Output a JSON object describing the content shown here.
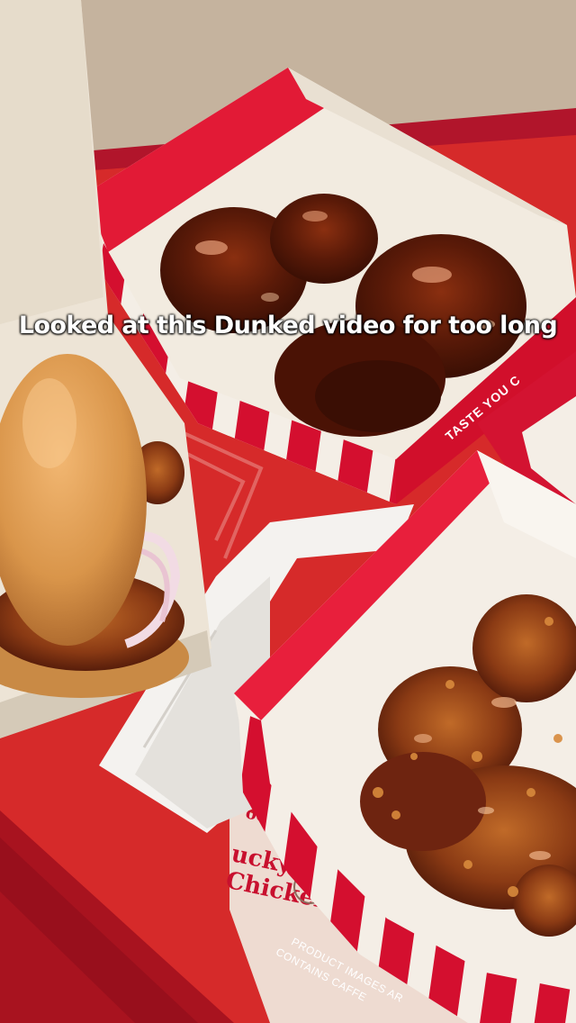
{
  "overlay": {
    "caption": "Looked at this Dunked video for too long"
  },
  "tray_mat": {
    "script_partial_1": "ucky",
    "script_partial_2": "Chicken",
    "script_partial_3": "ood",
    "fine_print_1": "PRODUCT IMAGES AR",
    "fine_print_2": "CONTAINS CAFFE"
  },
  "box_print": {
    "slogan_partial": "TASTE YOU C"
  },
  "colors": {
    "kfc_red": "#c8102e",
    "sauce_brown": "#5a1a0a",
    "bun_tan": "#d9954a",
    "table_wood": "#b8a48e"
  }
}
